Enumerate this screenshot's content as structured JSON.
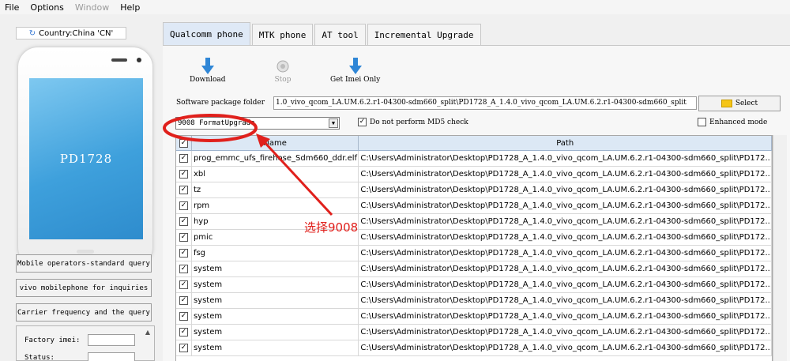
{
  "menu": [
    "File",
    "Options",
    "Window",
    "Help"
  ],
  "country": "Country:China 'CN'",
  "phone_model": "PD1728",
  "left_buttons": [
    "Mobile operators-standard query",
    "vivo mobilephone for inquiries",
    "Carrier frequency and the query"
  ],
  "info": {
    "factory_imei": "Factory imei:",
    "status": "Status:"
  },
  "tabs": [
    "Qualcomm phone",
    "MTK phone",
    "AT tool",
    "Incremental Upgrade"
  ],
  "tools": {
    "download": "Download",
    "stop": "Stop",
    "get_imei": "Get Imei Only"
  },
  "package": {
    "label": "Software package folder",
    "value": "1.0_vivo_qcom_LA.UM.6.2.r1-04300-sdm660_split\\PD1728_A_1.4.0_vivo_qcom_LA.UM.6.2.r1-04300-sdm660_split",
    "select_label": "Select"
  },
  "mode": {
    "selected": "9008 FormatUpgrade"
  },
  "options": {
    "no_md5": "Do not perform MD5 check",
    "enhanced": "Enhanced mode"
  },
  "table": {
    "headers": [
      "Name",
      "Path"
    ],
    "rows": [
      [
        "prog_emmc_ufs_firehose_Sdm660_ddr.elf",
        "C:\\Users\\Administrator\\Desktop\\PD1728_A_1.4.0_vivo_qcom_LA.UM.6.2.r1-04300-sdm660_split\\PD172..."
      ],
      [
        "xbl",
        "C:\\Users\\Administrator\\Desktop\\PD1728_A_1.4.0_vivo_qcom_LA.UM.6.2.r1-04300-sdm660_split\\PD172..."
      ],
      [
        "tz",
        "C:\\Users\\Administrator\\Desktop\\PD1728_A_1.4.0_vivo_qcom_LA.UM.6.2.r1-04300-sdm660_split\\PD172..."
      ],
      [
        "rpm",
        "C:\\Users\\Administrator\\Desktop\\PD1728_A_1.4.0_vivo_qcom_LA.UM.6.2.r1-04300-sdm660_split\\PD172..."
      ],
      [
        "hyp",
        "C:\\Users\\Administrator\\Desktop\\PD1728_A_1.4.0_vivo_qcom_LA.UM.6.2.r1-04300-sdm660_split\\PD172..."
      ],
      [
        "pmic",
        "C:\\Users\\Administrator\\Desktop\\PD1728_A_1.4.0_vivo_qcom_LA.UM.6.2.r1-04300-sdm660_split\\PD172..."
      ],
      [
        "fsg",
        "C:\\Users\\Administrator\\Desktop\\PD1728_A_1.4.0_vivo_qcom_LA.UM.6.2.r1-04300-sdm660_split\\PD172..."
      ],
      [
        "system",
        "C:\\Users\\Administrator\\Desktop\\PD1728_A_1.4.0_vivo_qcom_LA.UM.6.2.r1-04300-sdm660_split\\PD172..."
      ],
      [
        "system",
        "C:\\Users\\Administrator\\Desktop\\PD1728_A_1.4.0_vivo_qcom_LA.UM.6.2.r1-04300-sdm660_split\\PD172..."
      ],
      [
        "system",
        "C:\\Users\\Administrator\\Desktop\\PD1728_A_1.4.0_vivo_qcom_LA.UM.6.2.r1-04300-sdm660_split\\PD172..."
      ],
      [
        "system",
        "C:\\Users\\Administrator\\Desktop\\PD1728_A_1.4.0_vivo_qcom_LA.UM.6.2.r1-04300-sdm660_split\\PD172..."
      ],
      [
        "system",
        "C:\\Users\\Administrator\\Desktop\\PD1728_A_1.4.0_vivo_qcom_LA.UM.6.2.r1-04300-sdm660_split\\PD172..."
      ],
      [
        "system",
        "C:\\Users\\Administrator\\Desktop\\PD1728_A_1.4.0_vivo_qcom_LA.UM.6.2.r1-04300-sdm660_split\\PD172..."
      ]
    ]
  },
  "annotation": "选择9008",
  "colors": {
    "annotation": "#e0201c",
    "tab_active": "#dfe9f6",
    "header": "#dce8f5",
    "screen": "#3ea0dc",
    "tool_icon": "#2f86d6"
  },
  "icons": {
    "download": "down-arrow-icon",
    "stop": "stop-icon",
    "get_imei": "down-arrow-icon",
    "select": "folder-icon",
    "country": "refresh-icon"
  }
}
